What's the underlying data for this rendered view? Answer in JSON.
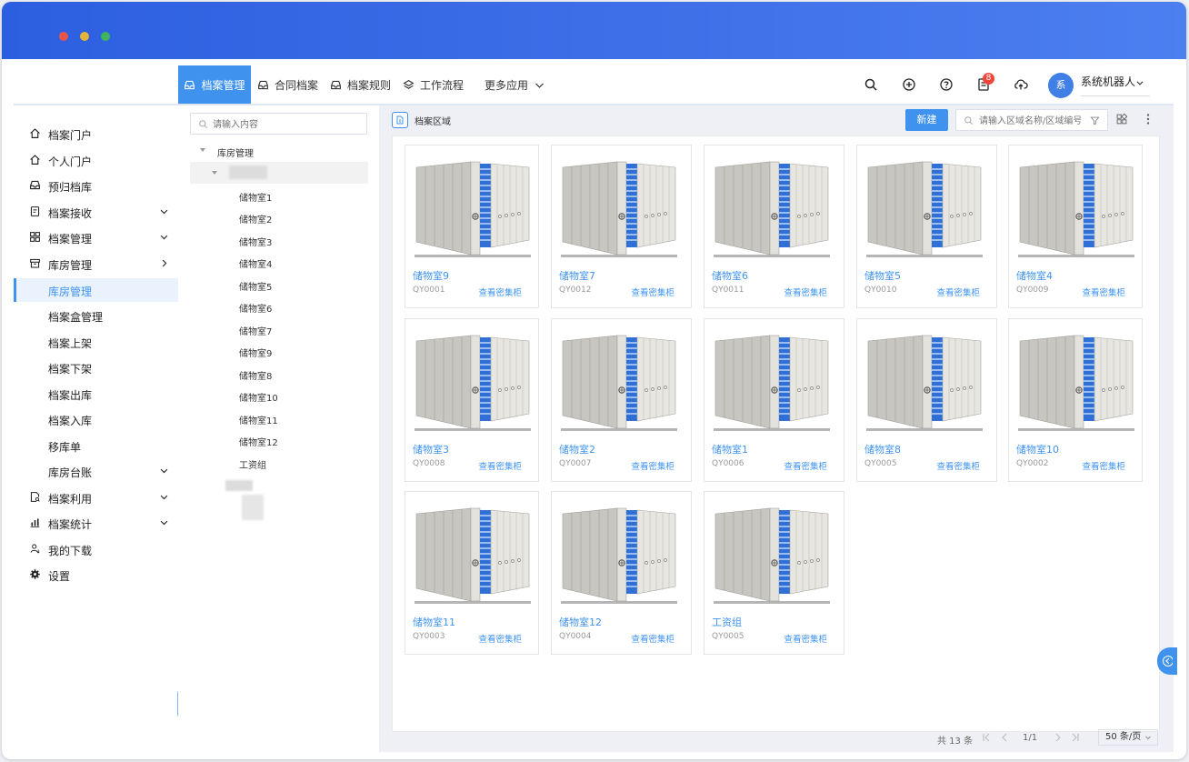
{
  "topnav": {
    "tabs": [
      {
        "label": "档案管理",
        "icon": "archive-tray-icon",
        "active": true
      },
      {
        "label": "合同档案",
        "icon": "archive-tray-icon",
        "active": false
      },
      {
        "label": "档案规则",
        "icon": "archive-tray-icon",
        "active": false
      },
      {
        "label": "工作流程",
        "icon": "layers-icon",
        "active": false
      },
      {
        "label": "更多应用",
        "icon": "chevron-down-icon",
        "active": false
      }
    ],
    "notification_count": "8",
    "avatar_text": "系",
    "user_name": "系统机器人"
  },
  "sidebar": {
    "items": [
      {
        "label": "档案门户",
        "icon": "home-icon"
      },
      {
        "label": "个人门户",
        "icon": "home-icon"
      },
      {
        "label": "预归档库",
        "icon": "inbox-icon"
      },
      {
        "label": "档案接收",
        "icon": "document-icon"
      },
      {
        "label": "档案管理",
        "icon": "grid-icon"
      },
      {
        "label": "库房管理",
        "icon": "box-icon"
      },
      {
        "label": "库房管理",
        "active": true
      },
      {
        "label": "档案盒管理"
      },
      {
        "label": "档案上架"
      },
      {
        "label": "档案下架"
      },
      {
        "label": "档案出库"
      },
      {
        "label": "档案入库"
      },
      {
        "label": "移库单"
      },
      {
        "label": "库房台账"
      },
      {
        "label": "档案利用",
        "icon": "search-document-icon"
      },
      {
        "label": "档案统计",
        "icon": "bar-chart-icon"
      },
      {
        "label": "我的下载",
        "icon": "user-download-icon"
      },
      {
        "label": "设置",
        "icon": "gear-icon"
      }
    ]
  },
  "tree": {
    "search_placeholder": "请输入内容",
    "root": "库房管理",
    "children": [
      "储物室1",
      "储物室2",
      "储物室3",
      "储物室4",
      "储物室5",
      "储物室6",
      "储物室7",
      "储物室9",
      "储物室8",
      "储物室10",
      "储物室11",
      "储物室12",
      "工资组"
    ]
  },
  "main": {
    "area_title": "档案区域",
    "new_button": "新建",
    "search_placeholder": "请输入区域名称/区域编号",
    "cards": [
      {
        "name": "储物室9",
        "code": "QY0001",
        "link": "查看密集柜"
      },
      {
        "name": "储物室7",
        "code": "QY0012",
        "link": "查看密集柜"
      },
      {
        "name": "储物室6",
        "code": "QY0011",
        "link": "查看密集柜"
      },
      {
        "name": "储物室5",
        "code": "QY0010",
        "link": "查看密集柜"
      },
      {
        "name": "储物室4",
        "code": "QY0009",
        "link": "查看密集柜"
      },
      {
        "name": "储物室3",
        "code": "QY0008",
        "link": "查看密集柜"
      },
      {
        "name": "储物室2",
        "code": "QY0007",
        "link": "查看密集柜"
      },
      {
        "name": "储物室1",
        "code": "QY0006",
        "link": "查看密集柜"
      },
      {
        "name": "储物室8",
        "code": "QY0005",
        "link": "查看密集柜"
      },
      {
        "name": "储物室10",
        "code": "QY0002",
        "link": "查看密集柜"
      },
      {
        "name": "储物室11",
        "code": "QY0003",
        "link": "查看密集柜"
      },
      {
        "name": "储物室12",
        "code": "QY0004",
        "link": "查看密集柜"
      },
      {
        "name": "工资组",
        "code": "QY0005",
        "link": "查看密集柜"
      }
    ],
    "pager": {
      "total": "共 13 条",
      "page": "1/1",
      "page_size": "50 条/页"
    }
  },
  "colors": {
    "accent": "#3f93ef",
    "titlebar": "#3f6fe8",
    "badge": "#f0453a"
  }
}
